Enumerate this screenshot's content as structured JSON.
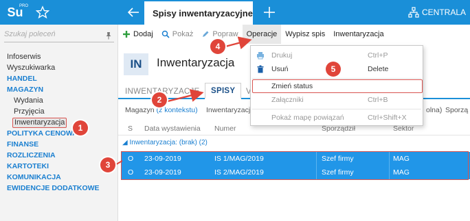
{
  "app": {
    "logo_text": "Su",
    "logo_badge": "PRO",
    "active_tab": "Spisy inwentaryzacyjne",
    "company": "CENTRALA"
  },
  "sidebar": {
    "search_placeholder": "Szukaj poleceń",
    "items": [
      {
        "label": "Infoserwis",
        "kind": "plain"
      },
      {
        "label": "Wyszukiwarka",
        "kind": "plain"
      },
      {
        "label": "HANDEL",
        "kind": "section"
      },
      {
        "label": "MAGAZYN",
        "kind": "section"
      },
      {
        "label": "Wydania",
        "kind": "sub"
      },
      {
        "label": "Przyjęcia",
        "kind": "sub"
      },
      {
        "label": "Inwentaryzacja",
        "kind": "active"
      },
      {
        "label": "POLITYKA CENOWA",
        "kind": "section"
      },
      {
        "label": "FINANSE",
        "kind": "section"
      },
      {
        "label": "ROZLICZENIA",
        "kind": "section"
      },
      {
        "label": "KARTOTEKI",
        "kind": "section"
      },
      {
        "label": "KOMUNIKACJA",
        "kind": "section"
      },
      {
        "label": "EWIDENCJE DODATKOWE",
        "kind": "section"
      }
    ]
  },
  "toolbar": {
    "add": "Dodaj",
    "show": "Pokaż",
    "edit": "Popraw",
    "operations": "Operacje",
    "write_list": "Wypisz spis",
    "inventory": "Inwentaryzacja"
  },
  "page": {
    "badge": "IN",
    "title": "Inwentaryzacja",
    "tabs": [
      "INWENTARYZACJE",
      "SPISY",
      "V"
    ]
  },
  "filters": {
    "warehouse_label": "Magazyn",
    "warehouse_value": "(z kontekstu)",
    "inventory_label": "Inwentaryzacj",
    "tail_1": "olna)",
    "tail_2": "Sporzą"
  },
  "grid": {
    "columns": [
      "S",
      "Data wystawienia",
      "Numer",
      "Sporządził",
      "Sektor"
    ],
    "group_label": "Inwentaryzacja:",
    "group_value": "(brak) (2)",
    "rows": [
      {
        "s": "O",
        "date": "23-09-2019",
        "number": "IS 1/MAG/2019",
        "author": "Szef firmy",
        "sector": "MAG"
      },
      {
        "s": "O",
        "date": "23-09-2019",
        "number": "IS 2/MAG/2019",
        "author": "Szef firmy",
        "sector": "MAG"
      }
    ]
  },
  "menu": {
    "items": [
      {
        "label": "Drukuj",
        "shortcut": "Ctrl+P",
        "disabled": true
      },
      {
        "label": "Usuń",
        "shortcut": "Delete",
        "disabled": false
      },
      {
        "label": "Zmień status",
        "shortcut": "",
        "disabled": false
      },
      {
        "label": "Załączniki",
        "shortcut": "Ctrl+B",
        "disabled": true
      },
      {
        "label": "Pokaż mapę powiązań",
        "shortcut": "Ctrl+Shift+X",
        "disabled": true
      }
    ]
  },
  "callouts": [
    "1",
    "2",
    "3",
    "4",
    "5"
  ],
  "colors": {
    "brand": "#1a8fd8",
    "selection": "#2196e8",
    "callout": "#e0453a"
  }
}
